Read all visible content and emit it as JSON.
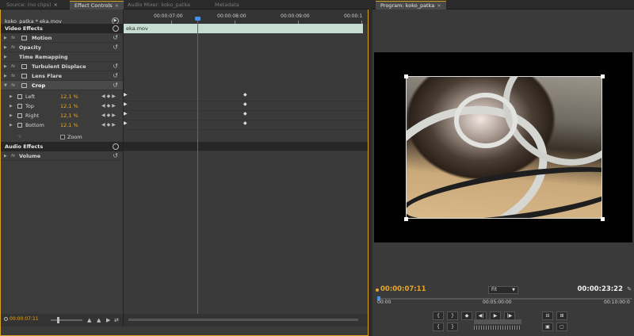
{
  "tabs_left": [
    {
      "label": "Source: (no clips)",
      "active": false
    },
    {
      "label": "Effect Controls",
      "active": true
    },
    {
      "label": "Audio Mixer: koko_patka",
      "active": false
    },
    {
      "label": "Metadata",
      "active": false
    }
  ],
  "tab_close_glyph": "×",
  "effect_controls": {
    "clip_header": "koko_patka * eka.mov",
    "sections": {
      "video": "Video Effects",
      "audio": "Audio Effects"
    },
    "effects": [
      {
        "label": "Motion",
        "fx": "fx",
        "has_icon": true
      },
      {
        "label": "Opacity",
        "fx": "fx",
        "has_icon": false
      },
      {
        "label": "Time Remapping",
        "fx": "",
        "has_icon": false
      },
      {
        "label": "Turbulent Displace",
        "fx": "fx",
        "has_icon": true
      },
      {
        "label": "Lens Flare",
        "fx": "fx",
        "has_icon": true
      },
      {
        "label": "Crop",
        "fx": "fx",
        "has_icon": true,
        "selected": true
      }
    ],
    "crop_props": [
      {
        "label": "Left",
        "value": "12,1 %"
      },
      {
        "label": "Top",
        "value": "12,1 %"
      },
      {
        "label": "Right",
        "value": "12,1 %"
      },
      {
        "label": "Bottom",
        "value": "12,1 %"
      }
    ],
    "zoom_label": "Zoom",
    "audio_effects": [
      {
        "label": "Volume",
        "fx": "fx"
      }
    ],
    "bottom_timecode": "00:00:07:11",
    "clip_bar_label": "eka.mov",
    "ruler_ticks": [
      "00:00:07:00",
      "00:00:08:00",
      "00:00:09:00",
      "00:00:1"
    ]
  },
  "program_monitor": {
    "tab": "Program: koko_patka",
    "current_timecode": "00:00:07:11",
    "duration": "00:00:23:22",
    "fit": "Fit",
    "ruler_labels": [
      "00:00",
      "00:05:00:00",
      "00:10:00:0"
    ]
  },
  "icons": {
    "keyframe": "◆",
    "prev_kf": "◀",
    "next_kf": "▶",
    "reset": "↺",
    "play": "▶",
    "step_back": "◀|",
    "step_fwd": "|▶",
    "mark_in": "{",
    "mark_out": "}",
    "wrench": "✎"
  },
  "colors": {
    "accent_timecode": "#e8a72e",
    "playhead": "#d23a3a",
    "panel_border_active": "#d9a224",
    "clip_bar": "#c7ddd1"
  }
}
